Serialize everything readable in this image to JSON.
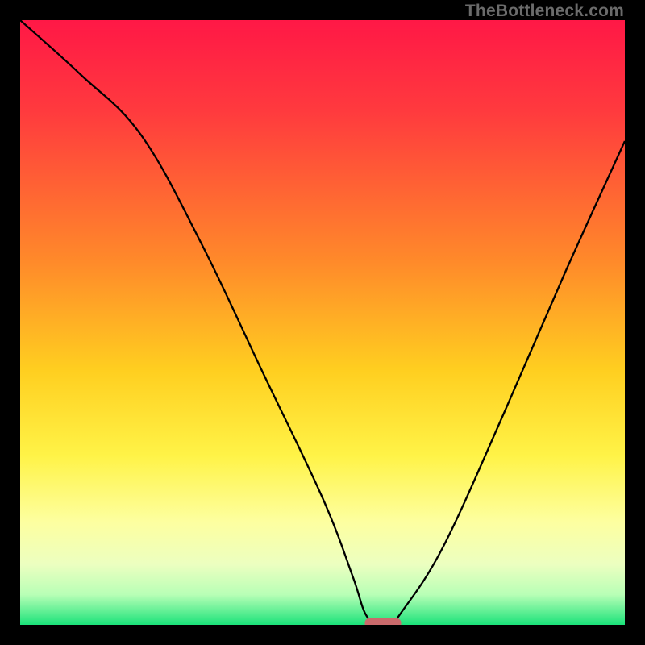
{
  "watermark": "TheBottleneck.com",
  "chart_data": {
    "type": "line",
    "title": "",
    "xlabel": "",
    "ylabel": "",
    "xlim": [
      0,
      100
    ],
    "ylim": [
      0,
      100
    ],
    "notes": "Line reads deviation (%) vs. a horizontal parameter; valley ≈ x=60 is the balance point (0% deviation). Values estimated from pixel positions; axes are unlabeled in the source image.",
    "series": [
      {
        "name": "bottleneck-deviation",
        "x": [
          0,
          10,
          20,
          30,
          40,
          50,
          55,
          57,
          59,
          61,
          63,
          70,
          80,
          90,
          100
        ],
        "values": [
          100,
          91,
          81,
          63,
          42,
          21,
          8,
          2,
          0,
          0,
          2,
          13,
          35,
          58,
          80
        ]
      }
    ],
    "marker": {
      "name": "balance-point",
      "x": 60,
      "y": 0,
      "width_x": 6
    },
    "gradient_stops": [
      {
        "offset": 0.0,
        "color": "#ff1846"
      },
      {
        "offset": 0.15,
        "color": "#ff3a3e"
      },
      {
        "offset": 0.4,
        "color": "#ff8a2a"
      },
      {
        "offset": 0.58,
        "color": "#ffcf20"
      },
      {
        "offset": 0.72,
        "color": "#fff347"
      },
      {
        "offset": 0.83,
        "color": "#fdffa0"
      },
      {
        "offset": 0.9,
        "color": "#ecffc0"
      },
      {
        "offset": 0.95,
        "color": "#b8ffb6"
      },
      {
        "offset": 1.0,
        "color": "#1be27a"
      }
    ]
  }
}
